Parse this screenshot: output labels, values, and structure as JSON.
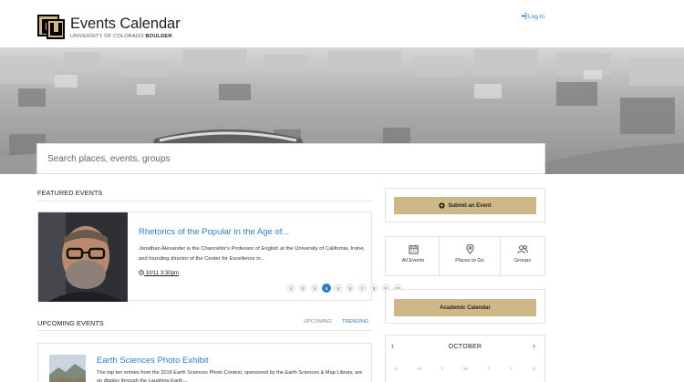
{
  "header": {
    "title": "Events Calendar",
    "subtitle_prefix": "UNIVERSITY OF COLORADO",
    "subtitle_bold": "BOULDER",
    "login": "Log In"
  },
  "search": {
    "placeholder": "Search places, events, groups"
  },
  "featured": {
    "heading": "FEATURED EVENTS",
    "title": "Rhetorics of the Popular in the Age of...",
    "description": "Jonathan Alexander is the Chancellor's Professor of English at the University of California, Irvine, and founding director of the Center for Excellence in...",
    "time": "10/11 3:30pm",
    "pages": [
      "1",
      "2",
      "3",
      "4",
      "5",
      "6",
      "7",
      "8",
      "9",
      "10"
    ],
    "active_page": "4"
  },
  "upcoming": {
    "heading": "UPCOMING EVENTS",
    "tabs": {
      "upcoming": "UPCOMING",
      "trending": "TRENDING"
    },
    "event_title": "Earth Sciences Photo Exhibit",
    "event_desc": "The top ten entries from the 2018 Earth Sciences Photo Contest, sponsored by the Earth Sciences & Map Library, are on display through the Laughing Earth..."
  },
  "sidebar": {
    "submit": "Submit an Event",
    "quick_links": [
      {
        "label": "All Events",
        "icon": "calendar-icon"
      },
      {
        "label": "Places to Go",
        "icon": "map-pin-icon"
      },
      {
        "label": "Groups",
        "icon": "users-icon"
      }
    ],
    "academic": "Academic Calendar",
    "calendar": {
      "month": "OCTOBER",
      "prev": "‹",
      "next": "›",
      "weekdays": [
        "S",
        "M",
        "T",
        "W",
        "T",
        "F",
        "S"
      ]
    }
  },
  "colors": {
    "accent": "#2b7fc4",
    "gold": "#cfb887",
    "logo_black": "#000000"
  }
}
